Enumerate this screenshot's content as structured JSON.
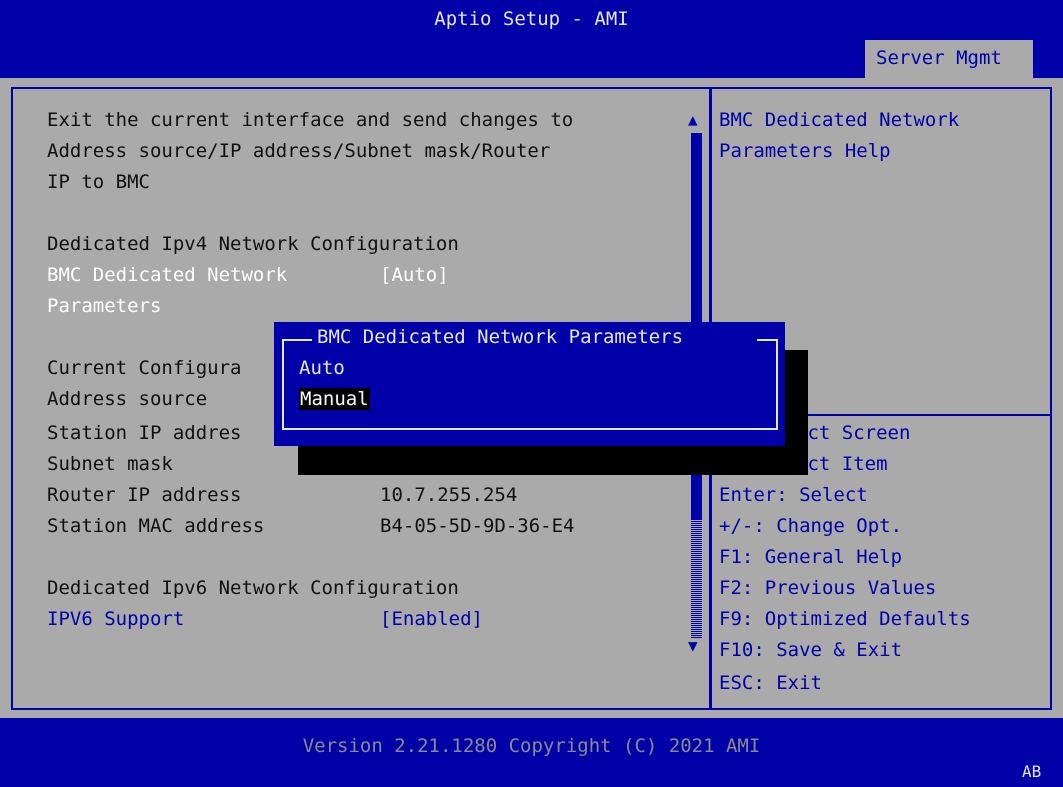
{
  "header": {
    "title": "Aptio Setup - AMI",
    "active_tab": "Server Mgmt"
  },
  "main": {
    "description_lines": [
      "Exit the current interface and send changes to",
      "Address source/IP address/Subnet mask/Router",
      "IP to BMC"
    ],
    "ipv4_section": "Dedicated Ipv4 Network Configuration",
    "bmc_param_label_1": "BMC Dedicated Network",
    "bmc_param_label_2": "Parameters",
    "bmc_param_value": "[Auto]",
    "current_config_label": "Current Configura",
    "address_source_label": "Address source",
    "station_ip_label": "Station IP addres",
    "subnet_mask_label": "Subnet mask",
    "router_ip_label": "Router IP address",
    "router_ip_value": "10.7.255.254",
    "mac_label": "Station MAC address",
    "mac_value": "B4-05-5D-9D-36-E4",
    "ipv6_section": "Dedicated Ipv6 Network Configuration",
    "ipv6_support_label": "IPV6 Support",
    "ipv6_support_value": "[Enabled]"
  },
  "help": {
    "line1": "BMC Dedicated Network",
    "line2": "Parameters Help"
  },
  "keys": [
    "ect Screen",
    "ect Item",
    "Enter: Select",
    "+/-: Change Opt.",
    "F1: General Help",
    "F2: Previous Values",
    "F9: Optimized Defaults",
    "F10: Save & Exit",
    "ESC: Exit"
  ],
  "popup": {
    "title": "BMC Dedicated Network Parameters",
    "options": [
      "Auto",
      "Manual"
    ],
    "selected": "Manual"
  },
  "footer": {
    "version": "Version 2.21.1280 Copyright (C) 2021 AMI",
    "corner": "AB"
  },
  "colors": {
    "background": "#aaaaaa",
    "accent_blue": "#0000a8",
    "text_white": "#ffffff"
  }
}
